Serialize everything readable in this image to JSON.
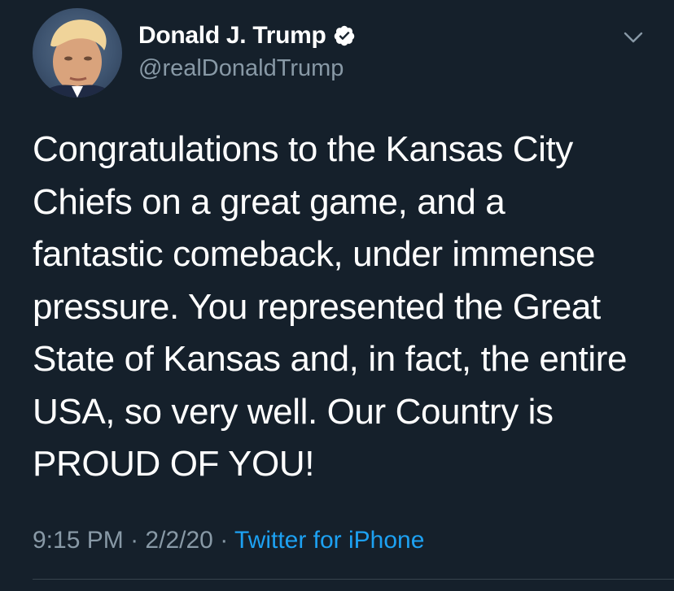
{
  "tweet": {
    "author": {
      "display_name": "Donald J. Trump",
      "handle": "@realDonaldTrump",
      "verified": true
    },
    "text": "Congratulations to the Kansas City\nChiefs on a great game, and a\nfantastic comeback, under immense\npressure. You represented the Great\nState of Kansas and, in fact, the entire\nUSA, so very well. Our Country is\nPROUD OF YOU!",
    "time": "9:15 PM",
    "separator": "·",
    "date": "2/2/20",
    "source": "Twitter for iPhone"
  },
  "icons": {
    "verified": "verified-badge-icon",
    "more": "chevron-down-icon"
  },
  "colors": {
    "background": "#15202b",
    "primary_text": "#ffffff",
    "secondary_text": "#8899a6",
    "link": "#1da1f2",
    "divider": "#38444d"
  }
}
